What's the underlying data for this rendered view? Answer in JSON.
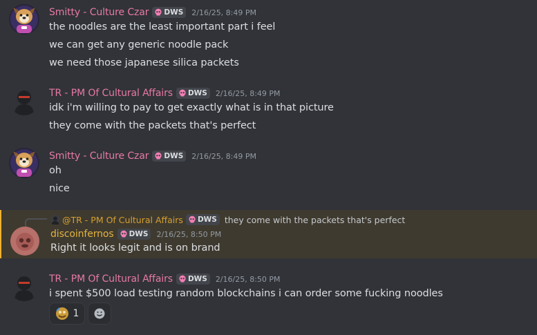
{
  "messages": [
    {
      "username": "Smitty - Culture Czar",
      "name_color": "#e879a6",
      "tag": "DWS",
      "timestamp": "2/16/25, 8:49 PM",
      "lines": [
        "the noodles are the least important part i feel",
        "we can get any generic noodle pack",
        "we need those japanese silica packets"
      ]
    },
    {
      "username": "TR - PM Of Cultural Affairs",
      "name_color": "#e879a6",
      "tag": "DWS",
      "timestamp": "2/16/25, 8:49 PM",
      "lines": [
        "idk i'm willing to pay to get exactly what is in that picture",
        "they come with the packets that's perfect"
      ]
    },
    {
      "username": "Smitty - Culture Czar",
      "name_color": "#e879a6",
      "tag": "DWS",
      "timestamp": "2/16/25, 8:49 PM",
      "lines": [
        "oh",
        "nice"
      ]
    },
    {
      "reply": {
        "mention": "@TR - PM Of Cultural Affairs",
        "tag": "DWS",
        "text": "they come with the packets that's perfect"
      },
      "username": "discoinfernos",
      "name_color": "#e3b341",
      "tag": "DWS",
      "timestamp": "2/16/25, 8:50 PM",
      "lines": [
        "Right it looks legit and is on brand"
      ]
    },
    {
      "username": "TR - PM Of Cultural Affairs",
      "name_color": "#e879a6",
      "tag": "DWS",
      "timestamp": "2/16/25, 8:50 PM",
      "lines": [
        "i spent $500 load testing random blockchains i can order some fucking noodles"
      ],
      "reactions": [
        {
          "icon": "custom-emoji-icon",
          "count": "1"
        },
        {
          "icon": "add-reaction-icon"
        }
      ]
    }
  ],
  "colors": {
    "background": "#313338",
    "mention_highlight": "#3f3a2f",
    "mention_bar": "#f0b232",
    "text": "#dbdee1",
    "muted": "#949ba4"
  }
}
